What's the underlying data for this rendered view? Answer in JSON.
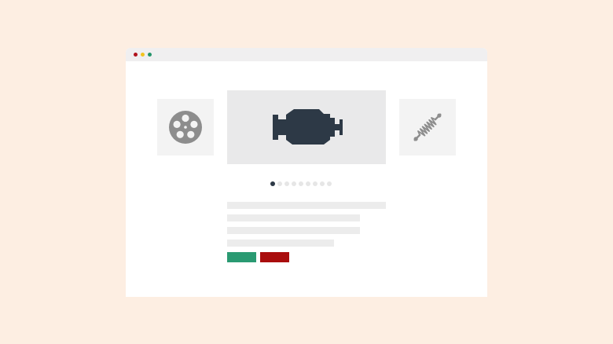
{
  "colors": {
    "page_background": "#fdeee2",
    "window_background": "#ffffff",
    "titlebar": "#f0eff0",
    "dot_red": "#b0121c",
    "dot_yellow": "#f2c31e",
    "dot_green": "#23946a",
    "thumbnail_background": "#f3f3f3",
    "main_slide_background": "#e9e9ea",
    "main_icon": "#2d3946",
    "side_icon": "#8d8d8d",
    "pagination_active": "#2d3946",
    "pagination_inactive": "#e6e6e6",
    "text_placeholder": "#ececec",
    "button_green": "#2a9a72",
    "button_red": "#a90d0d"
  },
  "carousel": {
    "slides": [
      {
        "icon": "film-reel-icon",
        "position": "previous"
      },
      {
        "icon": "car-engine-icon",
        "position": "current"
      },
      {
        "icon": "coil-spring-icon",
        "position": "next"
      }
    ],
    "pagination": {
      "total": 9,
      "active_index": 0
    }
  },
  "content": {
    "text_lines": 4
  },
  "actions": {
    "buttons": [
      {
        "icon": "none",
        "color": "#2a9a72"
      },
      {
        "icon": "none",
        "color": "#a90d0d"
      }
    ]
  }
}
